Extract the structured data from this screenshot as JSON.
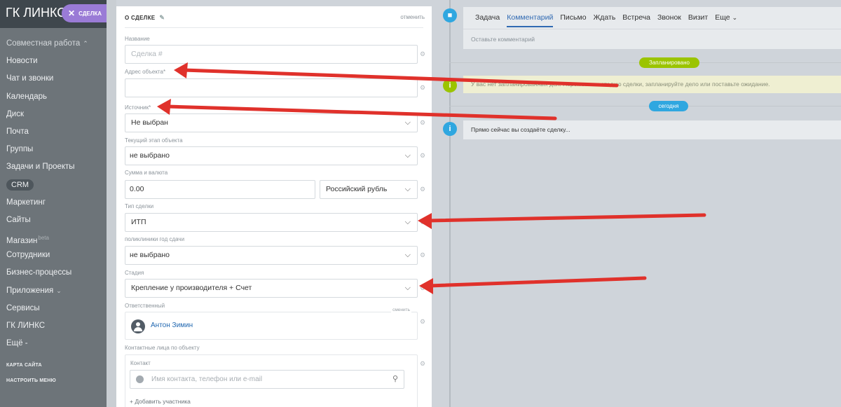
{
  "sidebar": {
    "brand": "ГК ЛИНКС",
    "items": [
      {
        "label": "Совместная работа",
        "group": true
      },
      {
        "label": "Новости"
      },
      {
        "label": "Чат и звонки"
      },
      {
        "label": "Календарь"
      },
      {
        "label": "Диск"
      },
      {
        "label": "Почта"
      },
      {
        "label": "Группы"
      },
      {
        "label": "Задачи и Проекты"
      },
      {
        "label": "CRM",
        "active": true
      },
      {
        "label": "Маркетинг"
      },
      {
        "label": "Сайты"
      },
      {
        "label": "Магазин",
        "sup": "beta"
      },
      {
        "label": "Сотрудники"
      },
      {
        "label": "Бизнес-процессы"
      },
      {
        "label": "Приложения",
        "chevron": true
      },
      {
        "label": "Сервисы"
      },
      {
        "label": "ГК ЛИНКС"
      },
      {
        "label": "Ещё -"
      }
    ],
    "site_map": "КАРТА САЙТА",
    "setup_menu": "НАСТРОИТЬ МЕНЮ"
  },
  "deal_pill": {
    "label": "СДЕЛКА"
  },
  "form": {
    "header": "О СДЕЛКЕ",
    "cancel": "отменить",
    "name_label": "Название",
    "name_placeholder": "Сделка #",
    "address_label": "Адрес объекта*",
    "address_value": "",
    "source_label": "Источник*",
    "source_value": "Не выбран",
    "stage_obj_label": "Текущий этап объекта",
    "stage_obj_value": "не выбрано",
    "sum_label": "Сумма и валюта",
    "sum_value": "0.00",
    "currency_value": "Российский рубль",
    "type_label": "Тип сделки",
    "type_value": "ИТП",
    "clinic_label": "поликлиники год сдачи",
    "clinic_value": "не выбрано",
    "stage_label": "Стадия",
    "stage_value": "Крепление у производителя + Счет",
    "responsible_label": "Ответственный",
    "responsible_change": "сменить",
    "responsible_name": "Антон Зимин",
    "contacts_label": "Контактные лица по объекту",
    "contact_sublabel": "Контакт",
    "contact_placeholder": "Имя контакта, телефон или e-mail",
    "add_participant": "+ Добавить участника"
  },
  "timeline": {
    "tabs": [
      "Задача",
      "Комментарий",
      "Письмо",
      "Ждать",
      "Встреча",
      "Звонок",
      "Визит",
      "Еще"
    ],
    "active_tab": "Комментарий",
    "comment_placeholder": "Оставьте комментарий",
    "planned_badge": "Запланировано",
    "info_warning": "У вас нет запланированных дел. Переместите стадию сделки, запланируйте дело или поставьте ожидание.",
    "today_badge": "сегодня",
    "now_text": "Прямо сейчас вы создаёте сделку..."
  },
  "colors": {
    "annotation_arrow": "#e0312b",
    "accent": "#2fa7e0",
    "green": "#9bc400"
  }
}
